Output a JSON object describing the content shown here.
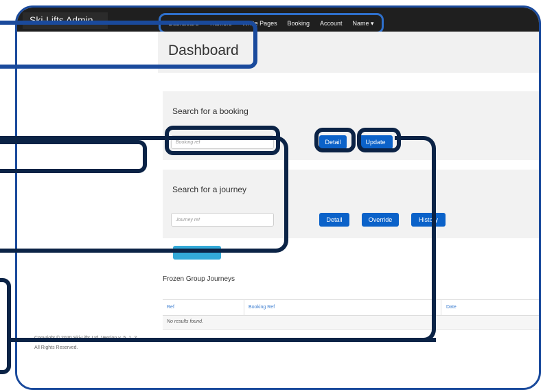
{
  "app": {
    "brand": "Ski-Lifts Admin"
  },
  "nav": {
    "items": [
      {
        "label": "Dashboard"
      },
      {
        "label": "Tranfers"
      },
      {
        "label": "White Pages"
      },
      {
        "label": "Booking"
      },
      {
        "label": "Account"
      },
      {
        "label": "Name ▾"
      }
    ]
  },
  "page": {
    "title": "Dashboard"
  },
  "booking_search": {
    "title": "Search for a booking",
    "placeholder": "Booking ref",
    "detail_label": "Detail",
    "update_label": "Update"
  },
  "journey_search": {
    "title": "Search for a journey",
    "placeholder": "Journey ref",
    "detail_label": "Detail",
    "override_label": "Override",
    "history_label": "History"
  },
  "frozen": {
    "heading": "Frozen Group Journeys",
    "columns": [
      "Ref",
      "Booking Ref",
      "Date"
    ],
    "empty_text": "No results found."
  },
  "footer": {
    "copyright": "Copyright © 2020 Ski-Lifts Ltd. Version v_5_1_2.",
    "rights": "All Rights Reserved."
  },
  "colors": {
    "topbar": "#1f1f1f",
    "primary_button": "#0b62c9",
    "teal_button": "#33a9d8",
    "callout": "#0b2346",
    "frame": "#1a4a9c"
  }
}
